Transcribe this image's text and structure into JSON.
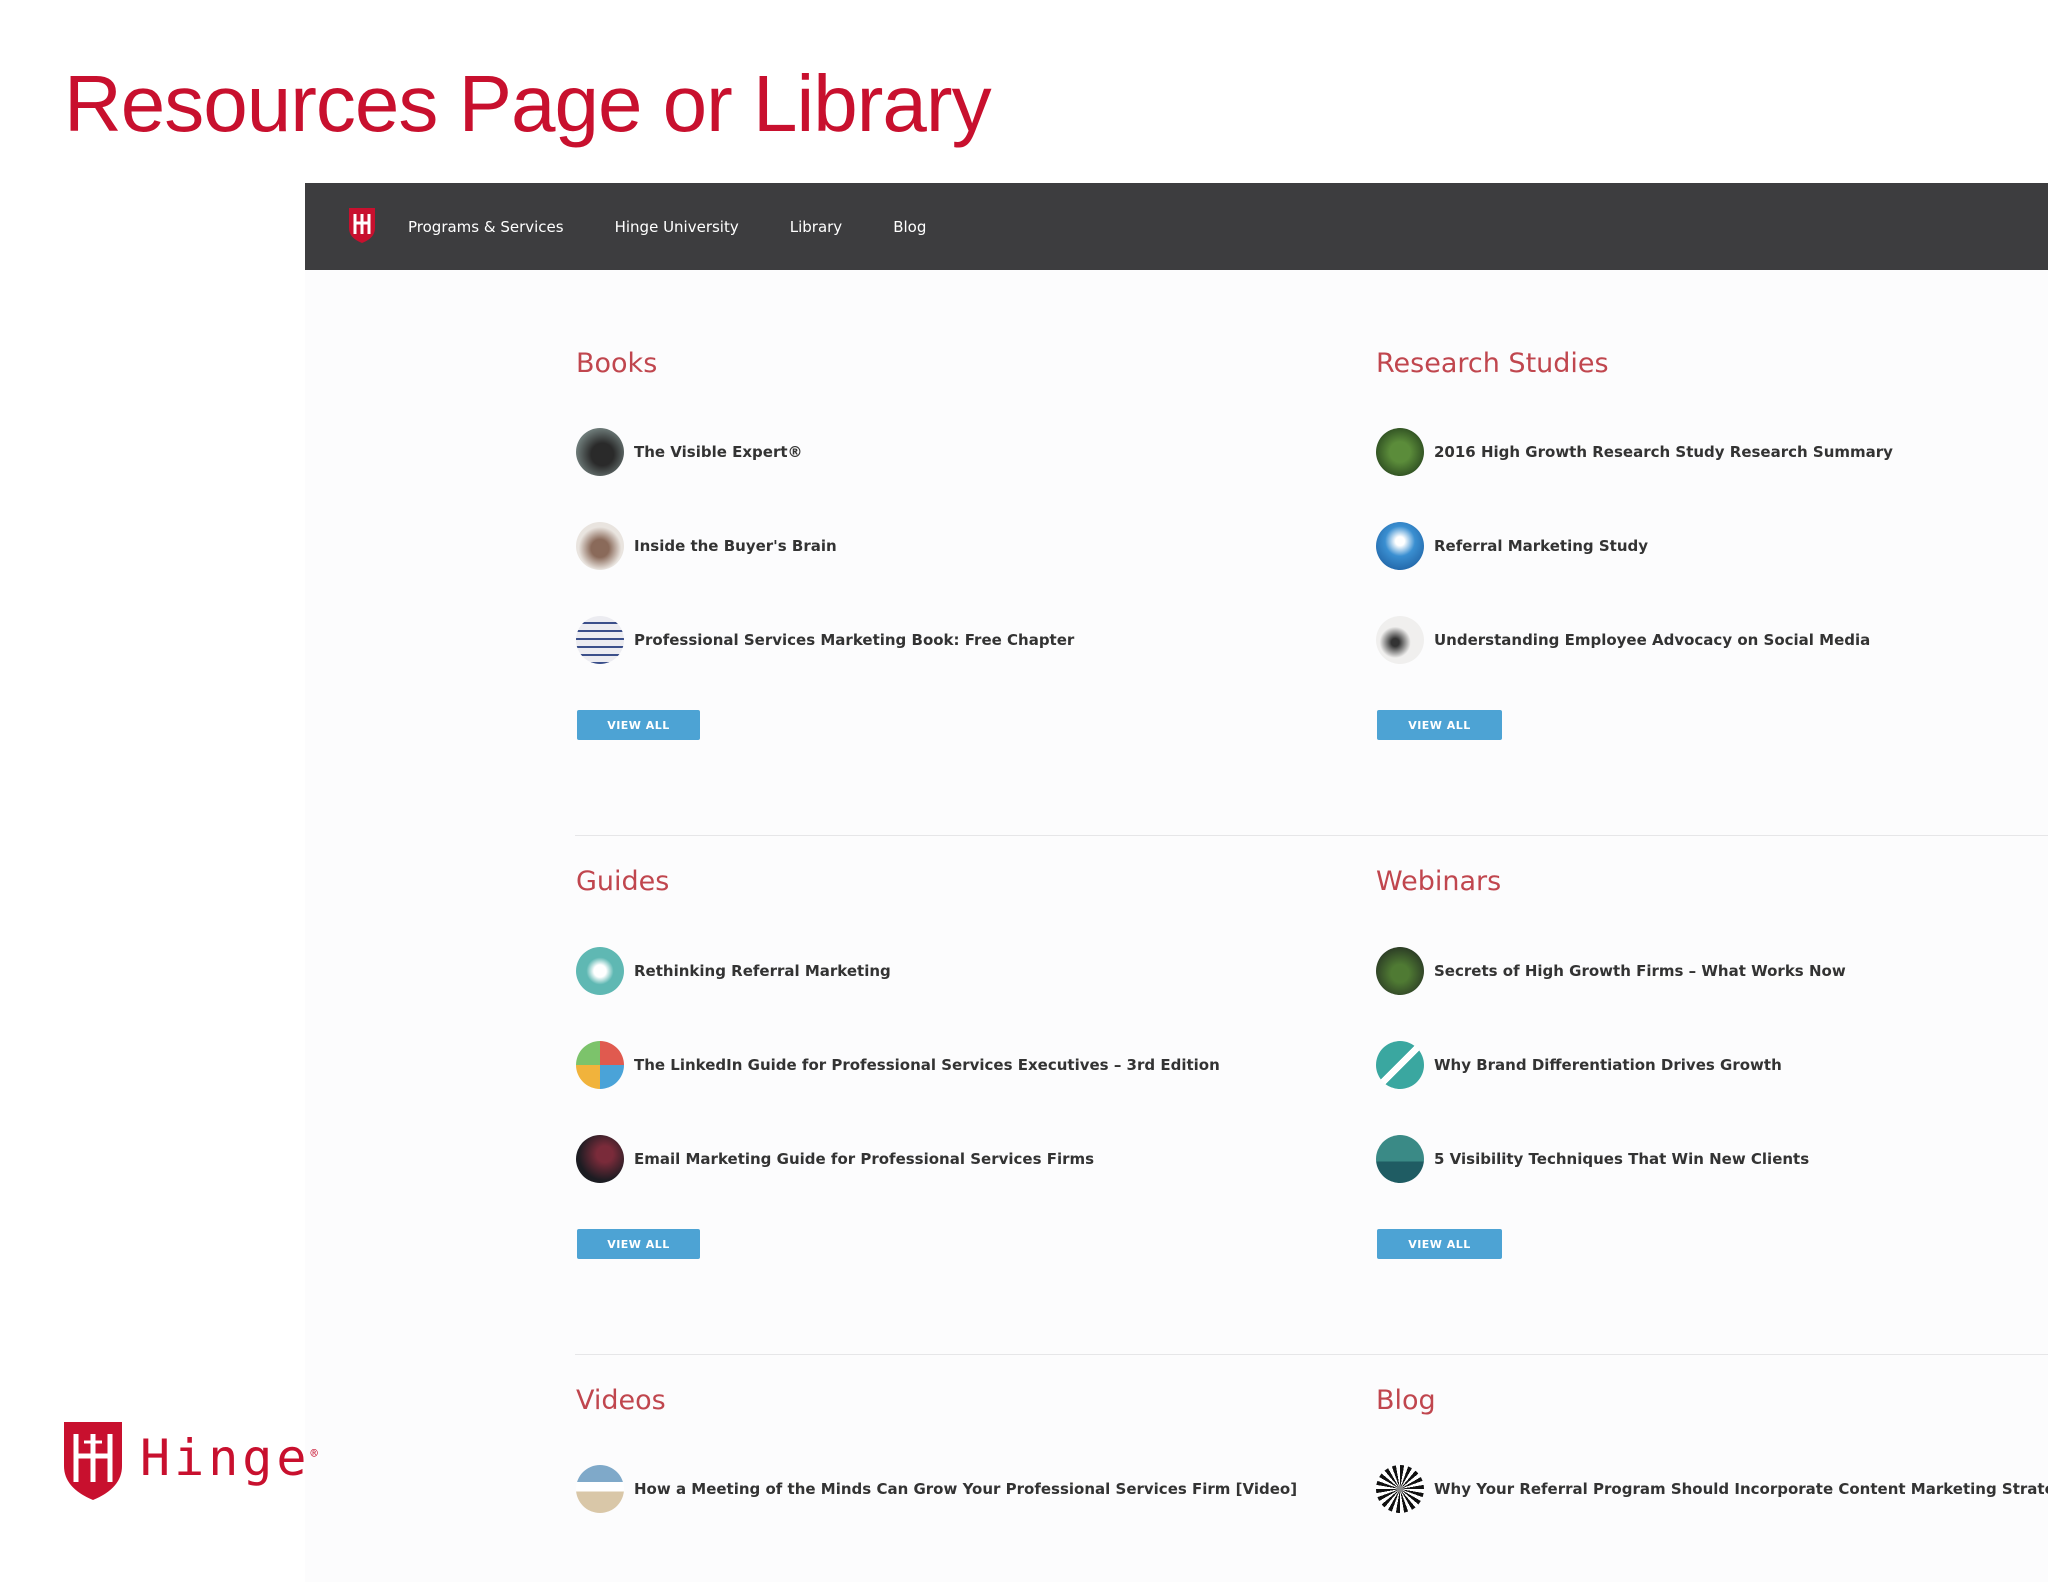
{
  "slide": {
    "title": "Resources Page or Library"
  },
  "nav": {
    "items": [
      "Programs & Services",
      "Hinge University",
      "Library",
      "Blog"
    ]
  },
  "sections": {
    "books": {
      "title": "Books",
      "items": [
        "The Visible Expert®",
        "Inside the Buyer's Brain",
        "Professional Services Marketing Book: Free Chapter"
      ],
      "button": "VIEW ALL"
    },
    "research": {
      "title": "Research Studies",
      "items": [
        "2016 High Growth Research Study Research Summary",
        "Referral Marketing Study",
        "Understanding Employee Advocacy on Social Media"
      ],
      "button": "VIEW ALL"
    },
    "guides": {
      "title": "Guides",
      "items": [
        "Rethinking Referral Marketing",
        "The LinkedIn Guide for Professional Services Executives – 3rd Edition",
        "Email Marketing Guide for Professional Services Firms"
      ],
      "button": "VIEW ALL"
    },
    "webinars": {
      "title": "Webinars",
      "items": [
        "Secrets of High Growth Firms – What Works Now",
        "Why Brand Differentiation Drives Growth",
        "5 Visibility Techniques That Win New Clients"
      ],
      "button": "VIEW ALL"
    },
    "videos": {
      "title": "Videos",
      "items": [
        "How a Meeting of the Minds Can Grow Your Professional Services Firm [Video]"
      ]
    },
    "blog": {
      "title": "Blog",
      "items": [
        "Why Your Referral Program Should Incorporate Content Marketing Strategies"
      ]
    }
  },
  "brand": {
    "name": "Hinge",
    "mark": "®"
  },
  "colors": {
    "brand_red": "#c8102e",
    "section_title": "#c0464e",
    "nav_bg": "#3d3d3f",
    "button": "#4da3d4"
  }
}
